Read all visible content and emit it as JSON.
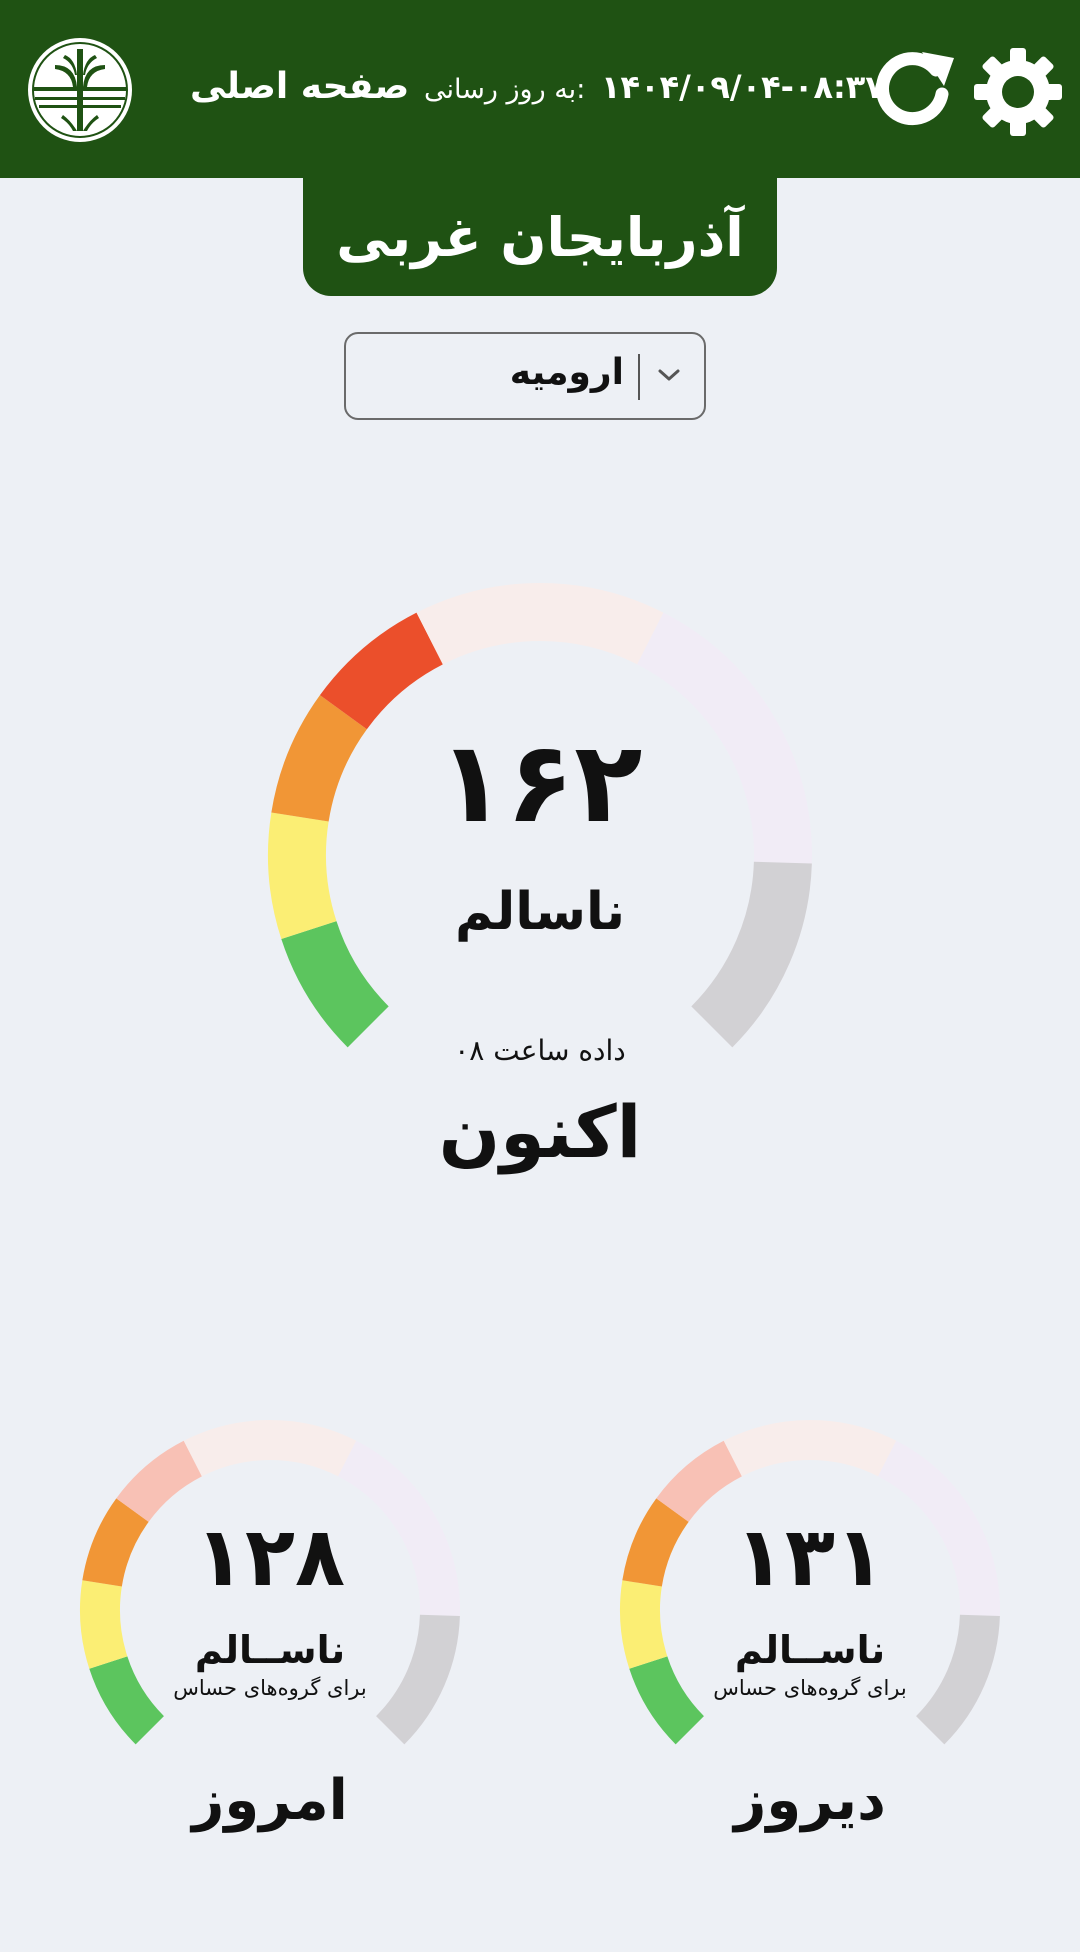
{
  "header": {
    "title": "صفحه اصلی",
    "updated_label": "به روز رسانی:",
    "updated_time": "۱۴۰۴/۰۹/۰۴-۰۸:۳۷",
    "refresh_icon": "refresh-icon",
    "settings_icon": "gear-icon",
    "logo_icon": "environment-logo"
  },
  "province": "آذربایجان غربی",
  "city_select": {
    "selected": "ارومیه",
    "icon": "chevron-down-icon"
  },
  "gauges": {
    "now": {
      "value": "۱۶۲",
      "level": 162,
      "status": "ناسالم",
      "hour_note": "داده ساعت ۰۸",
      "label": "اکنون"
    },
    "today": {
      "value": "۱۲۸",
      "level": 128,
      "status": "ناســالم",
      "sub": "برای گروه‌های حساس",
      "label": "امروز"
    },
    "yesterday": {
      "value": "۱۳۱",
      "level": 131,
      "status": "ناســالم",
      "sub": "برای گروه‌های حساس",
      "label": "دیروز"
    }
  },
  "colors": {
    "header_bg": "#1f5213",
    "good": "#5cc55e",
    "moderate": "#fbee74",
    "sensitive": "#f19636",
    "unhealthy": "#eb4f2b",
    "very_unhealthy": "#ecccc7",
    "hazardous": "#d6c9e5",
    "out_of_range": "#d2d1d4",
    "page_bg": "#edf0f5"
  }
}
